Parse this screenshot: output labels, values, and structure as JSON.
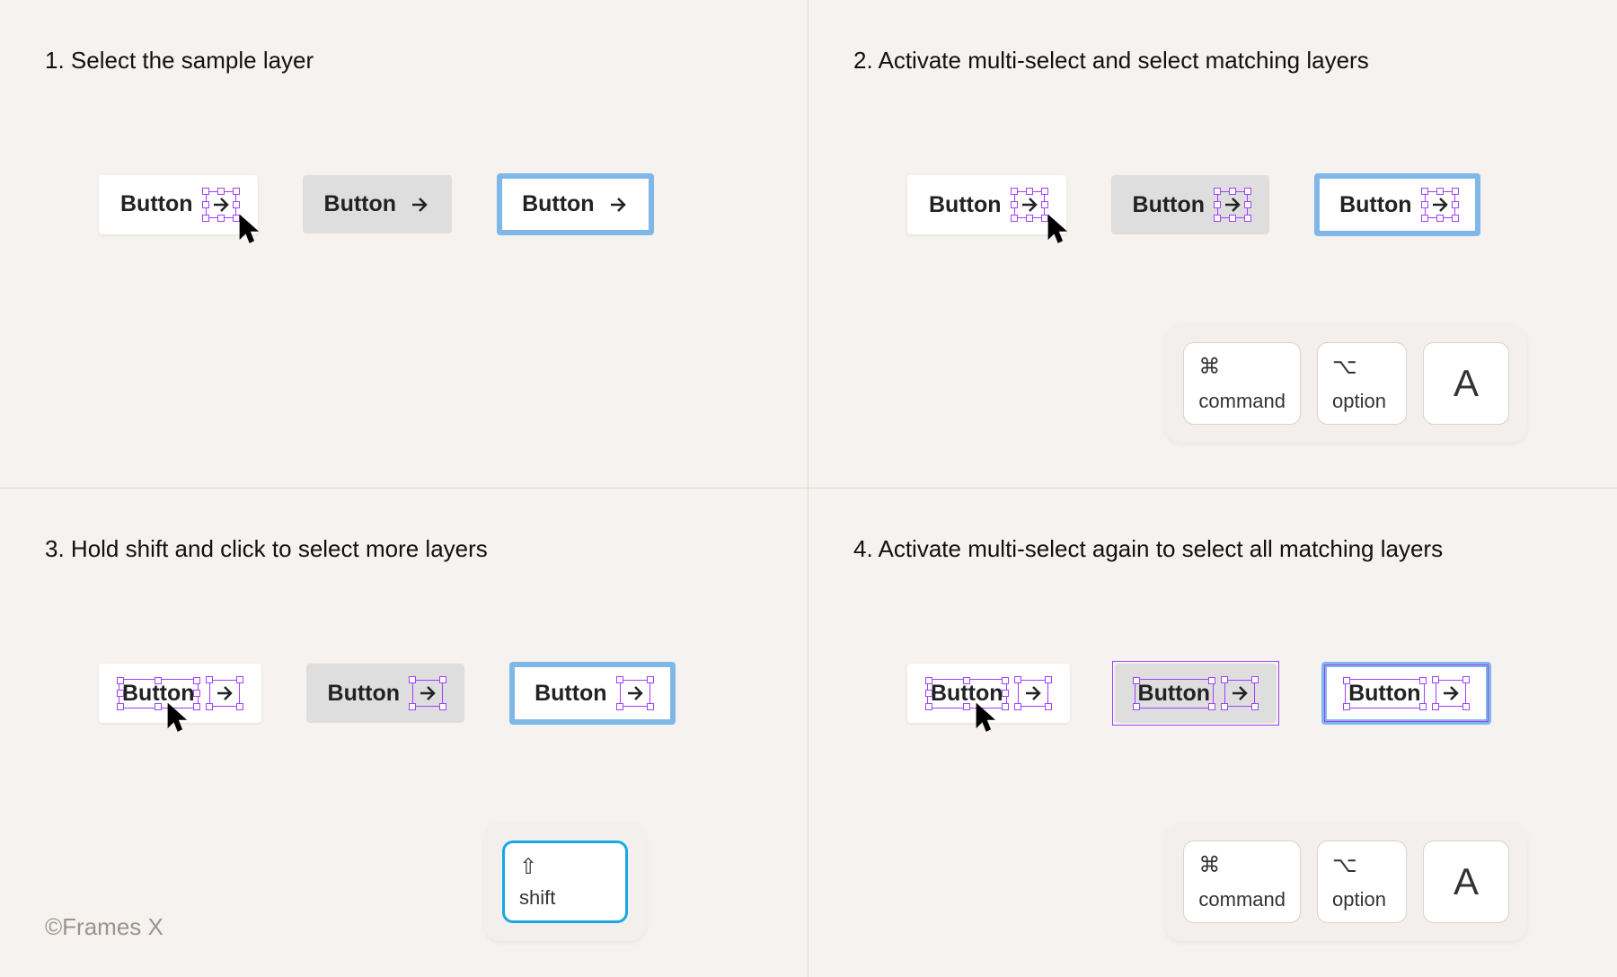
{
  "steps": {
    "s1": {
      "num": "1.",
      "title": "Select the sample layer"
    },
    "s2": {
      "num": "2.",
      "title": "Activate multi-select and select matching layers"
    },
    "s3": {
      "num": "3.",
      "title": "Hold shift and click to select more layers"
    },
    "s4": {
      "num": "4.",
      "title": "Activate multi-select again to select all matching layers"
    }
  },
  "button_label": "Button",
  "keys": {
    "command": {
      "symbol": "⌘",
      "label": "command"
    },
    "option": {
      "symbol": "⌥",
      "label": "option"
    },
    "letter": "A",
    "shift": {
      "symbol": "⇧",
      "label": "shift"
    }
  },
  "watermark": "©Frames X"
}
